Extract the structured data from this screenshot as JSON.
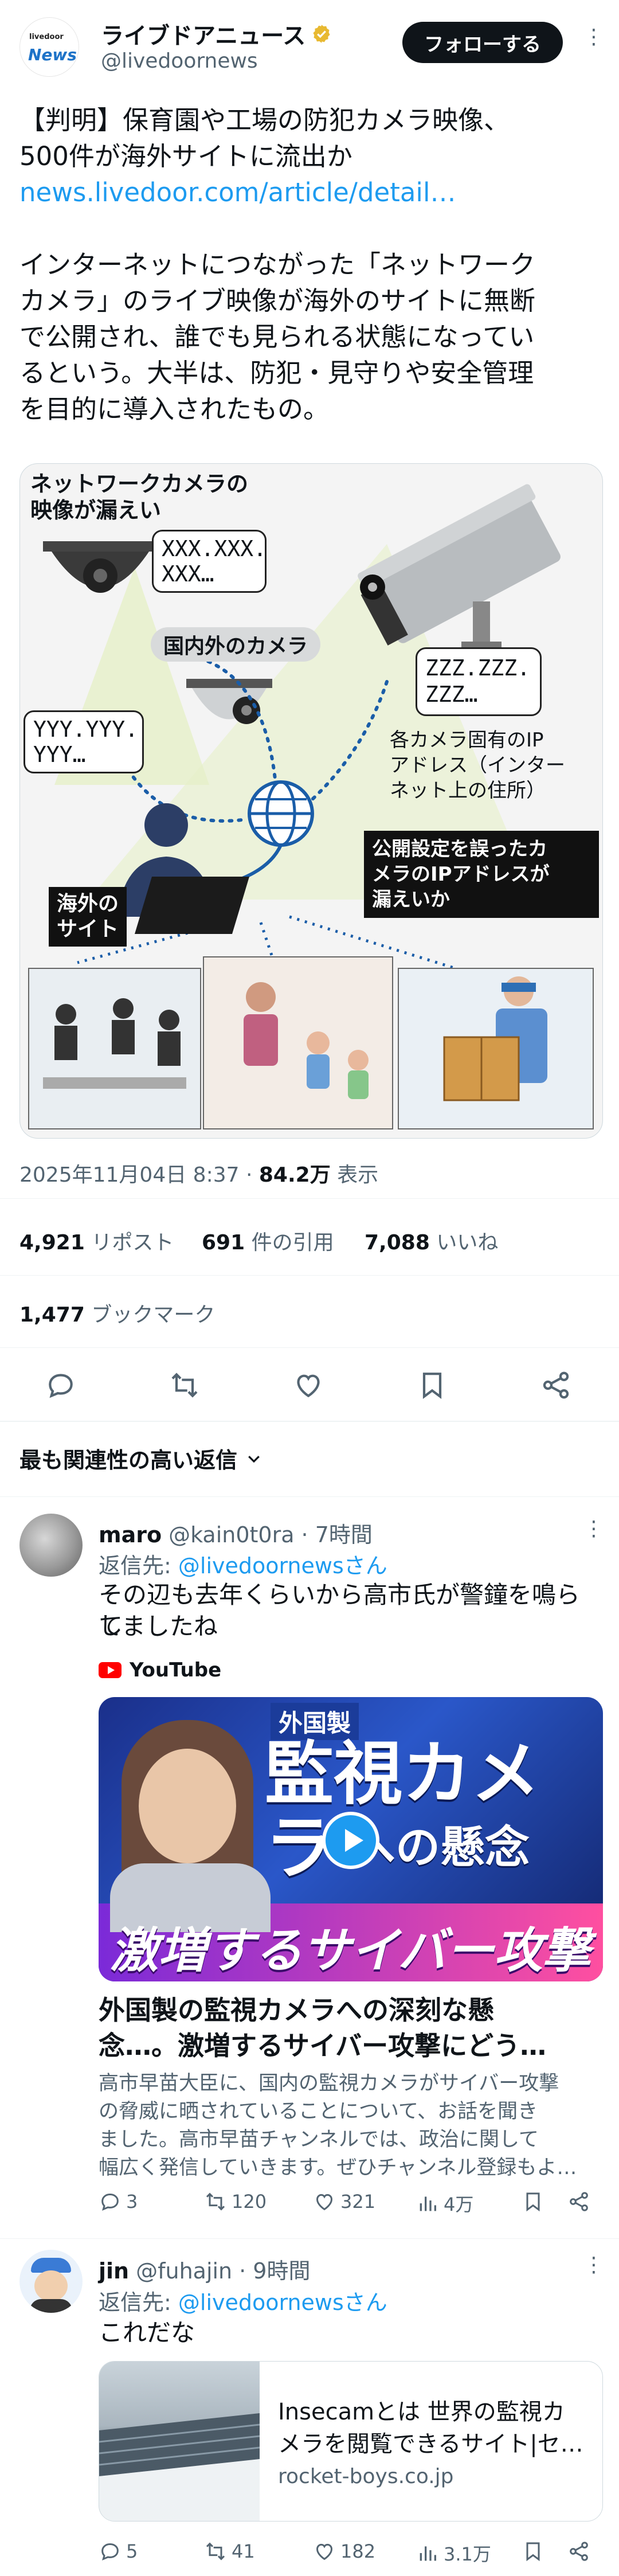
{
  "header": {
    "avatar_small": "livedoor",
    "avatar_brand": "News",
    "name": "ライブドアニュース",
    "handle": "@livedoornews",
    "follow_label": "フォローする"
  },
  "tweet": {
    "line1": "【判明】保育園や工場の防犯カメラ映像、",
    "line2": "500件が海外サイトに流出か",
    "link": "news.livedoor.com/article/detail…",
    "body": [
      "インターネットにつながった「ネットワーク",
      "カメラ」のライブ映像が海外のサイトに無断",
      "で公開され、誰でも見られる状態になってい",
      "るという。大半は、防犯・見守りや安全管理",
      "を目的に導入されたもの。"
    ]
  },
  "infographic": {
    "title_line1": "ネットワークカメラの",
    "title_line2": "映像が漏えい",
    "bubble1_l1": "XXX.XXX.",
    "bubble1_l2": "XXX…",
    "bubble2_l1": "ZZZ.ZZZ.",
    "bubble2_l2": "ZZZ…",
    "bubble3_l1": "YYY.YYY.",
    "bubble3_l2": "YYY…",
    "domestic_label": "国内外のカメラ",
    "ip_note_l1": "各カメラ固有のIP",
    "ip_note_l2": "アドレス（インター",
    "ip_note_l3": "ネット上の住所）",
    "leak_box_l1": "公開設定を誤ったカ",
    "leak_box_l2": "メラのIPアドレスが",
    "leak_box_l3": "漏えいか",
    "overseas_l1": "海外の",
    "overseas_l2": "サイト"
  },
  "meta": {
    "datetime": "2025年11月04日 8:37",
    "views_value": "84.2万",
    "views_label": "表示"
  },
  "stats": {
    "reposts_value": "4,921",
    "reposts_label": "リポスト",
    "quotes_value": "691",
    "quotes_label": "件の引用",
    "likes_value": "7,088",
    "likes_label": "いいね",
    "bookmarks_value": "1,477",
    "bookmarks_label": "ブックマーク"
  },
  "sort": {
    "label": "最も関連性の高い返信"
  },
  "replies": [
    {
      "name": "maro",
      "handle": "@kain0t0ra",
      "time": "· 7時間",
      "reply_to_label": "返信先:",
      "reply_to_handle": "@livedoornewsさん",
      "text_l1": "その辺も去年くらいから高市氏が警鐘を鳴らし",
      "text_l2": "てましたね",
      "yt_label": "YouTube",
      "thumb_top": "外国製",
      "thumb_main": "監視カメラ",
      "thumb_sub": "への懸念",
      "thumb_bottom": "激増するサイバー攻撃",
      "video_title_l1": "外国製の監視カメラへの深刻な懸",
      "video_title_l2": "念…。激増するサイバー攻撃にどう…",
      "video_desc_l1": "高市早苗大臣に、国内の監視カメラがサイバー攻撃",
      "video_desc_l2": "の脅威に晒されていることについて、お話を聞き",
      "video_desc_l3": "ました。高市早苗チャンネルでは、政治に関して",
      "video_desc_l4": "幅広く発信していきます。ぜひチャンネル登録もよ…",
      "replies_count": "3",
      "reposts_count": "120",
      "likes_count": "321",
      "views_count": "4万"
    },
    {
      "name": "jin",
      "handle": "@fuhajin",
      "time": "· 9時間",
      "reply_to_label": "返信先:",
      "reply_to_handle": "@livedoornewsさん",
      "text_l1": "これだな",
      "card_title_l1": "Insecamとは 世界の監視カ",
      "card_title_l2": "メラを閲覧できるサイト|セ…",
      "card_domain": "rocket-boys.co.jp",
      "replies_count": "5",
      "reposts_count": "41",
      "likes_count": "182",
      "views_count": "3.1万"
    }
  ],
  "colors": {
    "accent": "#1d9bf0",
    "text": "#0f1419",
    "muted": "#536471",
    "youtube": "#ff0000"
  }
}
